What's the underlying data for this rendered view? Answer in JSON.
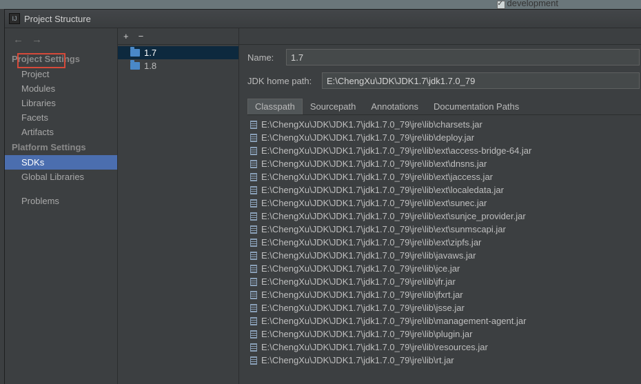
{
  "top_checkbox_label": "development",
  "window_title": "Project Structure",
  "sidebar": {
    "section1_title": "Project Settings",
    "section1_items": [
      "Project",
      "Modules",
      "Libraries",
      "Facets",
      "Artifacts"
    ],
    "section2_title": "Platform Settings",
    "section2_items": [
      "SDKs",
      "Global Libraries"
    ],
    "section3_items": [
      "Problems"
    ],
    "selected": "SDKs",
    "highlighted_box": "Project"
  },
  "sdk_list": {
    "items": [
      "1.7",
      "1.8"
    ],
    "selected": "1.7"
  },
  "detail": {
    "name_label": "Name:",
    "name_value": "1.7",
    "path_label": "JDK home path:",
    "path_value": "E:\\ChengXu\\JDK\\JDK1.7\\jdk1.7.0_79",
    "tabs": [
      "Classpath",
      "Sourcepath",
      "Annotations",
      "Documentation Paths"
    ],
    "active_tab": "Classpath",
    "jars": [
      "E:\\ChengXu\\JDK\\JDK1.7\\jdk1.7.0_79\\jre\\lib\\charsets.jar",
      "E:\\ChengXu\\JDK\\JDK1.7\\jdk1.7.0_79\\jre\\lib\\deploy.jar",
      "E:\\ChengXu\\JDK\\JDK1.7\\jdk1.7.0_79\\jre\\lib\\ext\\access-bridge-64.jar",
      "E:\\ChengXu\\JDK\\JDK1.7\\jdk1.7.0_79\\jre\\lib\\ext\\dnsns.jar",
      "E:\\ChengXu\\JDK\\JDK1.7\\jdk1.7.0_79\\jre\\lib\\ext\\jaccess.jar",
      "E:\\ChengXu\\JDK\\JDK1.7\\jdk1.7.0_79\\jre\\lib\\ext\\localedata.jar",
      "E:\\ChengXu\\JDK\\JDK1.7\\jdk1.7.0_79\\jre\\lib\\ext\\sunec.jar",
      "E:\\ChengXu\\JDK\\JDK1.7\\jdk1.7.0_79\\jre\\lib\\ext\\sunjce_provider.jar",
      "E:\\ChengXu\\JDK\\JDK1.7\\jdk1.7.0_79\\jre\\lib\\ext\\sunmscapi.jar",
      "E:\\ChengXu\\JDK\\JDK1.7\\jdk1.7.0_79\\jre\\lib\\ext\\zipfs.jar",
      "E:\\ChengXu\\JDK\\JDK1.7\\jdk1.7.0_79\\jre\\lib\\javaws.jar",
      "E:\\ChengXu\\JDK\\JDK1.7\\jdk1.7.0_79\\jre\\lib\\jce.jar",
      "E:\\ChengXu\\JDK\\JDK1.7\\jdk1.7.0_79\\jre\\lib\\jfr.jar",
      "E:\\ChengXu\\JDK\\JDK1.7\\jdk1.7.0_79\\jre\\lib\\jfxrt.jar",
      "E:\\ChengXu\\JDK\\JDK1.7\\jdk1.7.0_79\\jre\\lib\\jsse.jar",
      "E:\\ChengXu\\JDK\\JDK1.7\\jdk1.7.0_79\\jre\\lib\\management-agent.jar",
      "E:\\ChengXu\\JDK\\JDK1.7\\jdk1.7.0_79\\jre\\lib\\plugin.jar",
      "E:\\ChengXu\\JDK\\JDK1.7\\jdk1.7.0_79\\jre\\lib\\resources.jar",
      "E:\\ChengXu\\JDK\\JDK1.7\\jdk1.7.0_79\\jre\\lib\\rt.jar"
    ]
  }
}
